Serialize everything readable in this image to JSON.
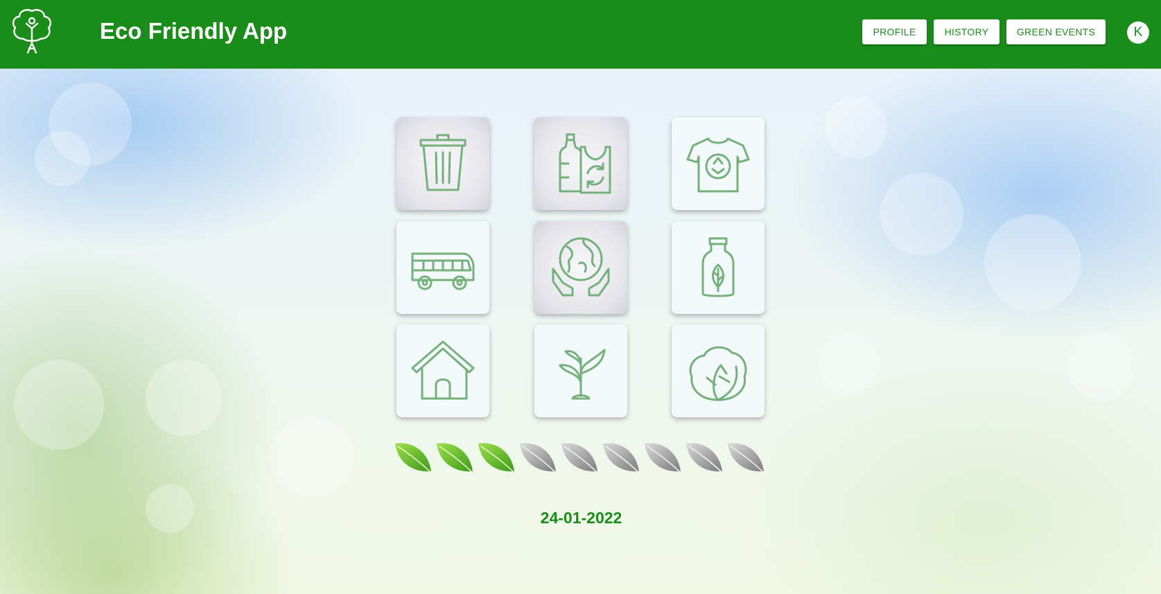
{
  "header": {
    "title": "Eco Friendly App",
    "logo_icon": "tree-person-icon",
    "nav": [
      {
        "label": "PROFILE"
      },
      {
        "label": "HISTORY"
      },
      {
        "label": "GREEN EVENTS"
      }
    ],
    "avatar_initial": "K"
  },
  "colors": {
    "brand_green": "#1a8c1a",
    "icon_green": "#74b07a",
    "leaf_active": "#6cbf2c",
    "leaf_inactive": "#9a9a9a"
  },
  "tiles": [
    {
      "icon": "trash-can-icon",
      "active": true
    },
    {
      "icon": "bottle-bag-recycle-icon",
      "active": true
    },
    {
      "icon": "recycled-tshirt-icon",
      "active": false
    },
    {
      "icon": "bus-icon",
      "active": false
    },
    {
      "icon": "earth-hands-icon",
      "active": true
    },
    {
      "icon": "eco-bottle-leaf-icon",
      "active": false
    },
    {
      "icon": "house-icon",
      "active": false
    },
    {
      "icon": "sprout-plant-icon",
      "active": false
    },
    {
      "icon": "cabbage-icon",
      "active": false
    }
  ],
  "rating": {
    "filled": 3,
    "total": 9,
    "icon": "leaf-icon"
  },
  "date": "24-01-2022"
}
